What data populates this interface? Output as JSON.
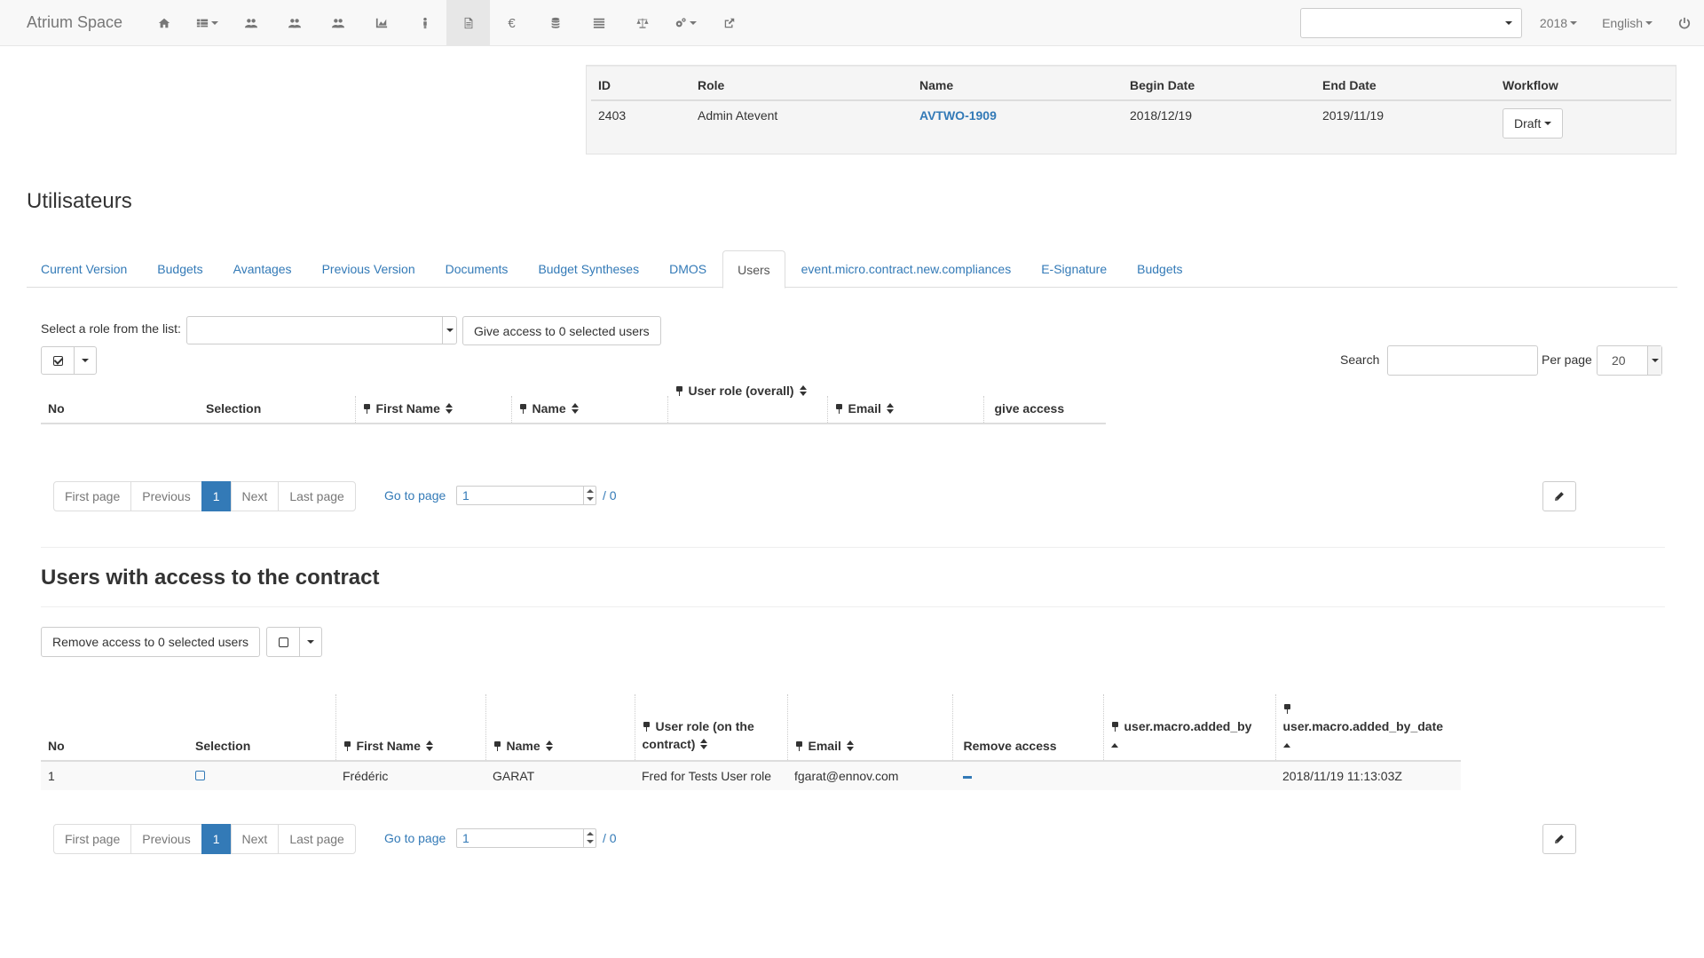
{
  "navbar": {
    "brand": "Atrium Space",
    "icons": [
      "home-icon",
      "list-dropdown-icon",
      "users-icon",
      "users-group-icon",
      "users-team-icon",
      "chart-icon",
      "person-icon",
      "document-icon",
      "euro-icon",
      "database-icon",
      "list-icon",
      "balance-scale-icon",
      "settings-dropdown-icon",
      "share-icon"
    ],
    "year": "2018",
    "language": "English"
  },
  "contract": {
    "headers": [
      "ID",
      "Role",
      "Name",
      "Begin Date",
      "End Date",
      "Workflow"
    ],
    "row": {
      "id": "2403",
      "role": "Admin Atevent",
      "name": "AVTWO-1909",
      "begin_date": "2018/12/19",
      "end_date": "2019/11/19",
      "workflow": "Draft"
    }
  },
  "page": {
    "title": "Utilisateurs"
  },
  "tabs": [
    {
      "label": "Current Version",
      "active": false
    },
    {
      "label": "Budgets",
      "active": false
    },
    {
      "label": "Avantages",
      "active": false
    },
    {
      "label": "Previous Version",
      "active": false
    },
    {
      "label": "Documents",
      "active": false
    },
    {
      "label": "Budget Syntheses",
      "active": false
    },
    {
      "label": "DMOS",
      "active": false
    },
    {
      "label": "Users",
      "active": true
    },
    {
      "label": "event.micro.contract.new.compliances",
      "active": false
    },
    {
      "label": "E-Signature",
      "active": false
    },
    {
      "label": "Budgets",
      "active": false
    }
  ],
  "users_section": {
    "role_label": "Select a role from the list:",
    "give_access_label": "Give access to 0 selected users",
    "search_label": "Search",
    "per_page_label": "Per page",
    "per_page_value": "20",
    "headers": {
      "no": "No",
      "selection": "Selection",
      "first_name": "First Name",
      "name": "Name",
      "user_role": "User role (overall)",
      "email": "Email",
      "give_access": "give access"
    }
  },
  "pagination": {
    "first": "First page",
    "previous": "Previous",
    "current": "1",
    "next": "Next",
    "last": "Last page",
    "goto_label": "Go to page",
    "goto_value": "1",
    "total": "/ 0"
  },
  "access_section": {
    "title": "Users with access to the contract",
    "remove_label": "Remove access to 0 selected users",
    "headers": {
      "no": "No",
      "selection": "Selection",
      "first_name": "First Name",
      "name": "Name",
      "user_role_line1": "User role (on the",
      "user_role_line2": "contract)",
      "email": "Email",
      "remove_access": "Remove access",
      "added_by": "user.macro.added_by",
      "added_by_date": "user.macro.added_by_date"
    },
    "rows": [
      {
        "no": "1",
        "first_name": "Frédéric",
        "name": "GARAT",
        "user_role": "Fred for Tests User role",
        "email": "fgarat@ennov.com",
        "added_by": "",
        "added_by_date": "2018/11/19 11:13:03Z"
      }
    ]
  },
  "colors": {
    "link": "#337ab7",
    "navbar_bg": "#f8f8f8",
    "active_page": "#337ab7"
  }
}
